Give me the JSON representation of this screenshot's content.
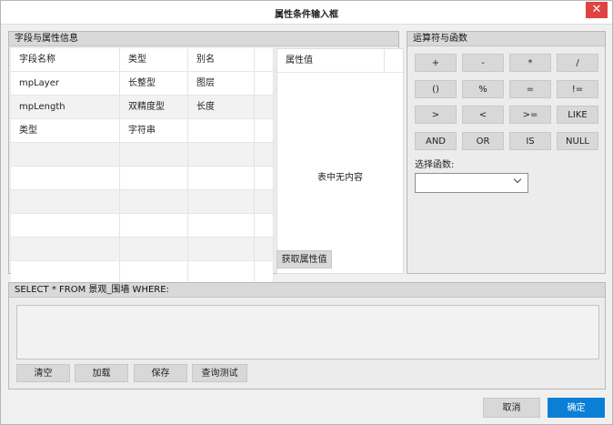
{
  "window": {
    "title": "属性条件输入框",
    "close_label": "✕"
  },
  "fields_group": {
    "title": "字段与属性信息",
    "columns": [
      "字段名称",
      "类型",
      "别名"
    ],
    "rows": [
      [
        "mpLayer",
        "长整型",
        "图层"
      ],
      [
        "mpLength",
        "双精度型",
        "长度"
      ],
      [
        "类型",
        "字符串",
        ""
      ]
    ]
  },
  "attr_panel": {
    "header": "属性值",
    "empty_text": "表中无内容",
    "get_values_label": "获取属性值"
  },
  "ops_group": {
    "title": "运算符与函数",
    "operators": [
      "+",
      "-",
      "*",
      "/",
      "()",
      "%",
      "=",
      "!=",
      ">",
      "<",
      ">=",
      "LIKE",
      "AND",
      "OR",
      "IS",
      "NULL"
    ],
    "select_function_label": "选择函数:",
    "select_function_value": ""
  },
  "sql_group": {
    "prefix": "SELECT * FROM 景观_围墙 WHERE:",
    "value": "",
    "buttons": [
      "清空",
      "加载",
      "保存",
      "查询测试"
    ]
  },
  "footer": {
    "cancel_label": "取消",
    "ok_label": "确定"
  },
  "colors": {
    "accent": "#0b7fd6",
    "close": "#e04343"
  }
}
